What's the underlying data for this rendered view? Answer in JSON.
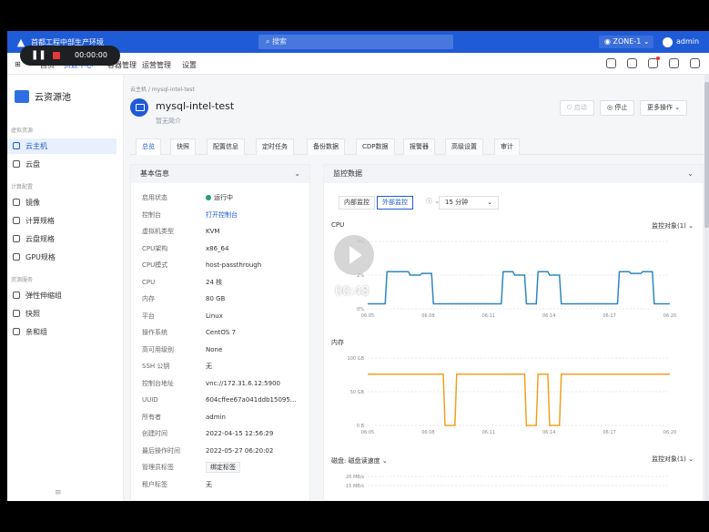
{
  "topbar": {
    "brand": "首都工程中部生产环境",
    "search_placeholder": "搜索",
    "zone": "ZONE-1",
    "user": "admin"
  },
  "recorder": {
    "time": "00:00:00"
  },
  "nav2": {
    "items": [
      "首页",
      "资源中心",
      "容器管理",
      "运营管理",
      "设置"
    ]
  },
  "sidebar": {
    "title": "云资源池",
    "groups": [
      "虚拟资源",
      "计算配置",
      "资源服务"
    ],
    "items": [
      "云主机",
      "云盘",
      "镜像",
      "计算规格",
      "云盘规格",
      "GPU规格",
      "弹性伸缩组",
      "快照",
      "亲和组"
    ],
    "collapse": "≡"
  },
  "vm": {
    "breadcrumb": "云主机  /  mysql-intel-test",
    "name": "mysql-intel-test",
    "description": "暂无简介",
    "actions": {
      "start": "启动",
      "stop": "停止",
      "more": "更多操作"
    }
  },
  "tabs": [
    "总览",
    "快照",
    "配置信息",
    "定时任务",
    "备份数据",
    "CDP数据",
    "报警器",
    "高级设置",
    "审计"
  ],
  "basic": {
    "title": "基本信息",
    "rows": [
      {
        "k": "启用状态",
        "v": "运行中"
      },
      {
        "k": "控制台",
        "v": "打开控制台"
      },
      {
        "k": "虚拟机类型",
        "v": "KVM"
      },
      {
        "k": "CPU架构",
        "v": "x86_64"
      },
      {
        "k": "CPU模式",
        "v": "host-passthrough"
      },
      {
        "k": "CPU",
        "v": "24 核"
      },
      {
        "k": "内存",
        "v": "80 GB"
      },
      {
        "k": "平台",
        "v": "Linux"
      },
      {
        "k": "操作系统",
        "v": "CentOS 7"
      },
      {
        "k": "高可用级别",
        "v": "None"
      },
      {
        "k": "SSH 公钥",
        "v": "无"
      },
      {
        "k": "控制台地址",
        "v": "vnc://172.31.6.12:5900"
      },
      {
        "k": "UUID",
        "v": "604cffee67a041ddb15095..."
      },
      {
        "k": "所有者",
        "v": "admin"
      },
      {
        "k": "创建时间",
        "v": "2022-04-15 12:56:29"
      },
      {
        "k": "最后操作时间",
        "v": "2022-05-27 06:20:02"
      },
      {
        "k": "管理员标签",
        "v": "绑定标签"
      },
      {
        "k": "租户标签",
        "v": "无"
      }
    ]
  },
  "monitor": {
    "title": "监控数据",
    "mode_inner": "内部监控",
    "mode_outer": "外部监控",
    "range": "15 分钟",
    "obj_label": "监控对象(1)",
    "disk_label": "磁盘:",
    "disk_select": "磁盘读速度"
  },
  "video": {
    "time": "00:48"
  },
  "chart_data": [
    {
      "type": "line",
      "title": "CPU",
      "x": [
        "06:05",
        "06:08",
        "06:11",
        "06:14",
        "06:17",
        "06:20"
      ],
      "ylabels": [
        "4%",
        "2%",
        "0%"
      ],
      "series": [
        {
          "color": "#2e86c1",
          "values": [
            0.3,
            0.3,
            2.2,
            2.2,
            2.0,
            2.1,
            0.3,
            0.3,
            0.3,
            0.3,
            0.3,
            0.3,
            2.2,
            2.0,
            0.3,
            2.2,
            2.0,
            0.3,
            0.3,
            0.3,
            0.3,
            0.3,
            2.2,
            2.1,
            2.2,
            0.3,
            0.3
          ]
        }
      ]
    },
    {
      "type": "line",
      "title": "内存",
      "x": [
        "06:05",
        "06:08",
        "06:11",
        "06:14",
        "06:17",
        "06:20"
      ],
      "ylabels": [
        "100 GB",
        "50 GB",
        "0 B"
      ],
      "series": [
        {
          "color": "#f0a020",
          "values": [
            76,
            76,
            76,
            76,
            76,
            76,
            76,
            0,
            76,
            76,
            76,
            76,
            76,
            76,
            0,
            76,
            0,
            76,
            76,
            76,
            76,
            76,
            76,
            76,
            76,
            76,
            76
          ]
        }
      ]
    },
    {
      "type": "line",
      "title": "磁盘",
      "ylabels": [
        "20 MB/s",
        "15 MB/s"
      ],
      "series": []
    }
  ]
}
